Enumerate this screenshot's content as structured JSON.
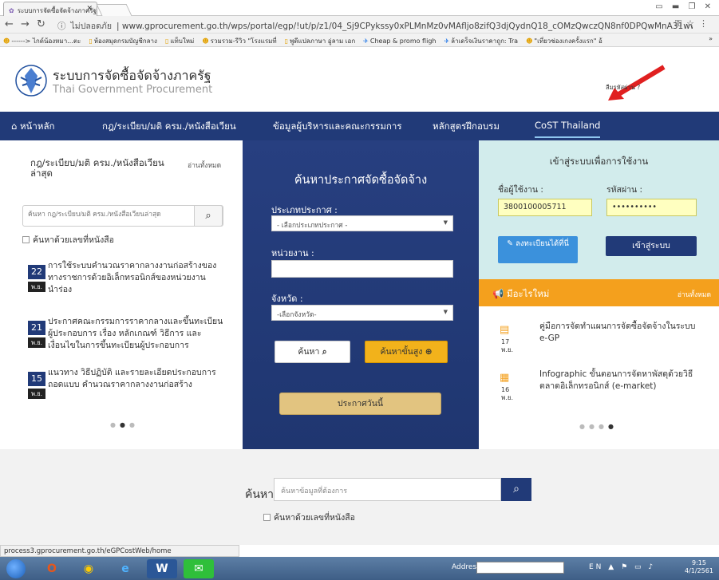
{
  "browser": {
    "tab_title": "ระบบการจัดซื้อจัดจ้างภาครัฐ",
    "security_label": "ไม่ปลอดภัย",
    "url": "www.gprocurement.go.th/wps/portal/egp/!ut/p/z1/04_Sj9CPykssy0xPLMnMz0vMAfljo8zifQ3djQydnQ18_cOMzQwczQN8nf0DPQwMnA31wwkpiAJKG-AAjgZA_...",
    "bookmarks": [
      {
        "label": "------> ไกด์น้องหมา...ตะ",
        "icon": "smile"
      },
      {
        "label": "ห้องสมุดกรมบัญชีกลาง",
        "icon": "doc"
      },
      {
        "label": "แท็บใหม่",
        "icon": "doc"
      },
      {
        "label": "รวมรวม-รีวิว \"โรงแรมที่",
        "icon": "smile"
      },
      {
        "label": "พูดีแปลภาษา อู่ลาม เอก",
        "icon": "doc"
      },
      {
        "label": "Cheap & promo fligh",
        "icon": "plane"
      },
      {
        "label": "ล้าเดร็จเงินราคาถูก: Tra",
        "icon": "plane"
      },
      {
        "label": "\"เที่ยวช่องเกงครั้งแรก\" อ้",
        "icon": "smile"
      }
    ],
    "bookmarks_more": "»",
    "status_text": "process3.gprocurement.go.th/eGPCostWeb/home"
  },
  "header": {
    "title": "ระบบการจัดซื้อจัดจ้างภาครัฐ",
    "subtitle": "Thai Government Procurement"
  },
  "nav": {
    "items": [
      {
        "label": "หน้าหลัก",
        "icon": "home"
      },
      {
        "label": "กฎ/ระเบียบ/มติ ครม./หนังสือเวียน"
      },
      {
        "label": "ข้อมูลผู้บริหารและคณะกรรมการ"
      },
      {
        "label": "หลักสูตรฝึกอบรม"
      },
      {
        "label": "CoST Thailand"
      }
    ]
  },
  "left": {
    "heading": "กฎ/ระเบียบ/มติ ครม./หนังสือเวียนล่าสุด",
    "read_all": "อ่านทั้งหมด",
    "search_placeholder": "ค้นหา กฎ/ระเบียบ/มติ ครม./หนังสือเวียนล่าสุด",
    "checkbox_label": "ค้นหาด้วยเลขที่หนังสือ",
    "news": [
      {
        "day": "22",
        "month": "พ.ย.",
        "text": "การใช้ระบบคำนวณราคากลางงานก่อสร้างของทางราชการด้วยอิเล็กทรอนิกส์ของหน่วยงานนำร่อง"
      },
      {
        "day": "21",
        "month": "พ.ย.",
        "text": "ประกาศคณะกรรมการราคากลางและขึ้นทะเบียนผู้ประกอบการ เรื่อง หลักเกณฑ์ วิธีการ และเงื่อนไขในการขึ้นทะเบียนผู้ประกอบการ"
      },
      {
        "day": "15",
        "month": "พ.ย.",
        "text": "แนวทาง วิธีปฏิบัติ และรายละเอียดประกอบการถอดแบบ คำนวณราคากลางงานก่อสร้าง"
      }
    ]
  },
  "center": {
    "title": "ค้นหาประกาศจัดซื้อจัดจ้าง",
    "announce_type_label": "ประเภทประกาศ :",
    "announce_type_value": "- เลือกประเภทประกาศ -",
    "agency_label": "หน่วยงาน :",
    "agency_value": "",
    "province_label": "จังหวัด :",
    "province_value": "-เลือกจังหวัด-",
    "search_button": "ค้นหา",
    "advanced_button": "ค้นหาขั้นสูง",
    "today_button": "ประกาศวันนี้"
  },
  "login": {
    "title": "เข้าสู่ระบบเพื่อการใช้งาน",
    "username_label": "ชื่อผู้ใช้งาน :",
    "username_value": "3800100005711",
    "password_label": "รหัสผ่าน :",
    "password_value": "••••••••••",
    "forgot": "ลืมรหัสผ่าน ?",
    "register_button": "ลงทะเบียนได้ที่นี่",
    "login_button": "เข้าสู่ระบบ"
  },
  "whats_new": {
    "title": "มีอะไรใหม่",
    "read_all": "อ่านทั้งหมด",
    "items": [
      {
        "day": "17",
        "month": "พ.ย.",
        "text": "คู่มือการจัดทำแผนการจัดซื้อจัดจ้างในระบบ e-GP"
      },
      {
        "day": "16",
        "month": "พ.ย.",
        "text": "Infographic ขั้นตอนการจัดหาพัสดุด้วยวิธีตลาดอิเล็กทรอนิกส์ (e-market)"
      }
    ]
  },
  "bottom": {
    "label": "ค้นหา :",
    "placeholder": "ค้นหาข้อมูลที่ต้องการ",
    "checkbox_label": "ค้นหาด้วยเลขที่หนังสือ"
  },
  "taskbar": {
    "address_label": "Address",
    "lang": "EN",
    "time": "9:15",
    "date": "4/1/2561"
  },
  "colors": {
    "nav_bg": "#213a78",
    "accent_orange": "#f4a01d",
    "login_bg": "#d2ecec"
  }
}
